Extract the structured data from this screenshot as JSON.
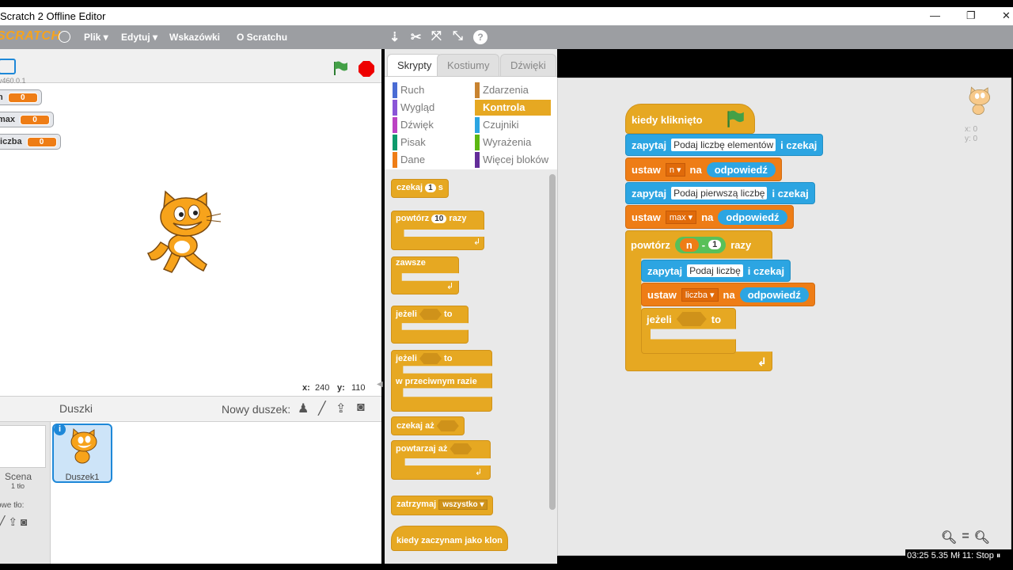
{
  "window": {
    "title": "Scratch 2 Offline Editor",
    "minimize": "—",
    "restore": "❐",
    "close": "✕"
  },
  "menu": {
    "logo": "SCRATCH",
    "items": [
      "Plik ▾",
      "Edytuj ▾",
      "Wskazówki",
      "O Scratchu"
    ]
  },
  "stage": {
    "version": "v460.0.1",
    "monitors": [
      {
        "name": "n",
        "value": "0"
      },
      {
        "name": "max",
        "value": "0"
      },
      {
        "name": "liczba",
        "value": "0"
      }
    ],
    "coords": {
      "x_label": "x:",
      "x": "240",
      "y_label": "y:",
      "y": "110"
    }
  },
  "sprites": {
    "header": "Duszki",
    "new_sprite": "Nowy duszek:",
    "scene": {
      "label": "Scena",
      "backdrops": "1 tło",
      "new_backdrop": "owe tło:"
    },
    "items": [
      {
        "name": "Duszek1"
      }
    ]
  },
  "palette": {
    "tabs": [
      "Skrypty",
      "Kostiumy",
      "Dźwięki"
    ],
    "categories_left": [
      {
        "label": "Ruch",
        "color": "#4a6cd4"
      },
      {
        "label": "Wygląd",
        "color": "#8a55d7"
      },
      {
        "label": "Dźwięk",
        "color": "#bb42c3"
      },
      {
        "label": "Pisak",
        "color": "#0e9a6c"
      },
      {
        "label": "Dane",
        "color": "#ee7d16"
      }
    ],
    "categories_right": [
      {
        "label": "Zdarzenia",
        "color": "#c88330"
      },
      {
        "label": "Kontrola",
        "color": "#e6a822"
      },
      {
        "label": "Czujniki",
        "color": "#2ca5e2"
      },
      {
        "label": "Wyrażenia",
        "color": "#5cb712"
      },
      {
        "label": "Więcej bloków",
        "color": "#632d99"
      }
    ],
    "blocks": {
      "wait": "czekaj",
      "wait_num": "1",
      "wait_unit": "s",
      "repeat": "powtórz",
      "repeat_num": "10",
      "repeat_unit": "razy",
      "forever": "zawsze",
      "if": "jeżeli",
      "then": "to",
      "else": "w przeciwnym razie",
      "wait_until": "czekaj aż",
      "repeat_until": "powtarzaj aż",
      "stop": "zatrzymaj",
      "stop_opt": "wszystko ▾",
      "clone_hat": "kiedy zaczynam jako klon"
    }
  },
  "script": {
    "hat": "kiedy kliknięto",
    "ask1": "zapytaj",
    "ask1_text": "Podaj liczbę elementów",
    "ask_wait": "i czekaj",
    "set1": "ustaw",
    "set1_var": "n ▾",
    "set_to": "na",
    "answer": "odpowiedź",
    "ask2_text": "Podaj pierwszą liczbę",
    "set2_var": "max ▾",
    "repeat": "powtórz",
    "rep_var": "n",
    "rep_op": "-",
    "rep_num": "1",
    "rep_unit": "razy",
    "ask3_text": "Podaj liczbę",
    "set3_var": "liczba ▾",
    "if": "jeżeli",
    "then": "to",
    "sprite_x": "x: 0",
    "sprite_y": "y: 0"
  },
  "overlay": {
    "text": "03:25 5.35 Mł 11: Stop ⏸"
  }
}
